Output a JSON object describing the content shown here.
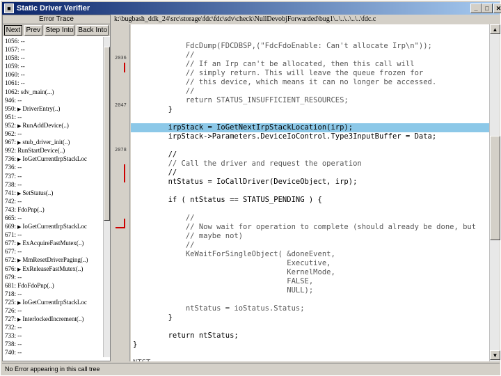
{
  "window": {
    "title": "Static Driver Verifier"
  },
  "frame": {
    "header": "Error Trace",
    "buttons": [
      "Next",
      "Prev",
      "Step Into",
      "Back Into"
    ]
  },
  "trace": [
    {
      "text": "1056: --"
    },
    {
      "text": "1057: --"
    },
    {
      "text": "1058: --"
    },
    {
      "text": "1059: --"
    },
    {
      "text": "1060: --"
    },
    {
      "text": "1061: --"
    },
    {
      "text": "1062: sdv_main(...)"
    },
    {
      "text": "946: --"
    },
    {
      "text": "950:",
      "arrow": true,
      "call": "DriverEntry(..)"
    },
    {
      "text": "951: --"
    },
    {
      "text": "952:",
      "arrow": true,
      "call": "RunAddDevice(..)"
    },
    {
      "text": "962: --"
    },
    {
      "text": "967:",
      "arrow": true,
      "call": "stub_driver_init(..)"
    },
    {
      "text": "992: RunStartDevice(..)"
    },
    {
      "text": "736:",
      "arrow": true,
      "call": "IoGetCurrentIrpStackLoc"
    },
    {
      "text": "736: --"
    },
    {
      "text": "737: --"
    },
    {
      "text": "738: --"
    },
    {
      "text": "741:",
      "arrow": true,
      "call": "SetStatus(..)"
    },
    {
      "text": "742: --"
    },
    {
      "text": "743: FdoPnp(..)"
    },
    {
      "text": "665: --"
    },
    {
      "text": "669:",
      "arrow": true,
      "call": "IoGetCurrentIrpStackLoc"
    },
    {
      "text": "671: --"
    },
    {
      "text": "677:",
      "arrow": true,
      "call": "ExAcquireFastMutex(..)"
    },
    {
      "text": "677: --"
    },
    {
      "text": "672:",
      "arrow": true,
      "call": "MmResetDriverPaging(..)"
    },
    {
      "text": "676:",
      "arrow": true,
      "call": "ExReleaseFastMutex(..)"
    },
    {
      "text": "679: --"
    },
    {
      "text": "681: FdoFdoPnp(..)"
    },
    {
      "text": "718: --"
    },
    {
      "text": "725:",
      "arrow": true,
      "call": "IoGetCurrentIrpStackLoc"
    },
    {
      "text": "726: --"
    },
    {
      "text": "727:",
      "arrow": true,
      "call": "InterlockedIncrement(..)"
    },
    {
      "text": "732: --"
    },
    {
      "text": "733: --"
    },
    {
      "text": "738: --"
    },
    {
      "text": "740: --"
    }
  ],
  "path": "k:\\bugbash_ddk_24\\src\\storage\\fdc\\fdc\\sdv\\check\\NullDevobjForwarded\\bug1\\..\\..\\..\\..\\..\\fdc.c",
  "gutter_numbers": [
    "2036",
    "2047",
    "2078"
  ],
  "code": [
    {
      "text": "            FdcDump(FDCDBSP,(\"FdcFdoEnable: Can't allocate Irp\\n\"));",
      "faint": true
    },
    {
      "text": "            //",
      "faint": true
    },
    {
      "text": "            // If an Irp can't be allocated, then this call will",
      "faint": true
    },
    {
      "text": "            // simply return. This will leave the queue frozen for",
      "faint": true
    },
    {
      "text": "            // this device, which means it can no longer be accessed.",
      "faint": true
    },
    {
      "text": "            //",
      "faint": true
    },
    {
      "text": "            return STATUS_INSUFFICIENT_RESOURCES;",
      "faint": true
    },
    {
      "text": "        }"
    },
    {
      "text": ""
    },
    {
      "text": "        irpStack = IoGetNextIrpStackLocation(irp);",
      "highlight": true
    },
    {
      "text": "        irpStack->Parameters.DeviceIoControl.Type3InputBuffer = Data;"
    },
    {
      "text": ""
    },
    {
      "text": "        //"
    },
    {
      "text": "        // Call the driver and request the operation",
      "faint": true
    },
    {
      "text": "        //"
    },
    {
      "text": "        ntStatus = IoCallDriver(DeviceObject, irp);"
    },
    {
      "text": ""
    },
    {
      "text": "        if ( ntStatus == STATUS_PENDING ) {"
    },
    {
      "text": ""
    },
    {
      "text": "            //",
      "faint": true
    },
    {
      "text": "            // Now wait for operation to complete (should already be done, but",
      "faint": true
    },
    {
      "text": "            // maybe not)",
      "faint": true
    },
    {
      "text": "            //",
      "faint": true
    },
    {
      "text": "            KeWaitForSingleObject( &doneEvent,",
      "faint": true
    },
    {
      "text": "                                   Executive,",
      "faint": true
    },
    {
      "text": "                                   KernelMode,",
      "faint": true
    },
    {
      "text": "                                   FALSE,",
      "faint": true
    },
    {
      "text": "                                   NULL);",
      "faint": true
    },
    {
      "text": ""
    },
    {
      "text": "            ntStatus = ioStatus.Status;",
      "faint": true
    },
    {
      "text": "        }"
    },
    {
      "text": ""
    },
    {
      "text": "        return ntStatus;"
    },
    {
      "text": "}"
    },
    {
      "text": ""
    },
    {
      "text": "NTST",
      "faint": true
    }
  ],
  "status_bar": "No Error appearing in this call tree"
}
